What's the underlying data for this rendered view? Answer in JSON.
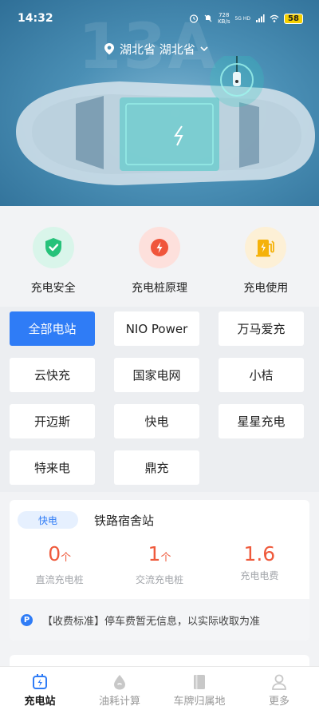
{
  "status_bar": {
    "time": "14:32",
    "network_speed_value": "728",
    "network_speed_unit": "KB/s",
    "network_type": "5G HD",
    "battery": "58"
  },
  "hero": {
    "background_text": "13A",
    "location": "湖北省 湖北省"
  },
  "features": [
    {
      "label": "充电安全",
      "icon": "shield-check-icon"
    },
    {
      "label": "充电桩原理",
      "icon": "lightning-icon"
    },
    {
      "label": "充电使用",
      "icon": "charging-pile-icon"
    }
  ],
  "filters": {
    "selected": "全部电站",
    "items": [
      "全部电站",
      "NIO Power",
      "万马爱充",
      "云快充",
      "国家电网",
      "小桔",
      "开迈斯",
      "快电",
      "星星充电",
      "特来电",
      "鼎充"
    ]
  },
  "station": {
    "type": "快电",
    "name": "铁路宿舍站",
    "dc_count": "0",
    "dc_unit": "个",
    "dc_label": "直流充电桩",
    "ac_count": "1",
    "ac_unit": "个",
    "ac_label": "交流充电桩",
    "fee": "1.6",
    "fee_label": "充电电费",
    "parking_icon": "P",
    "parking_note": "【收费标准】停车费暂无信息，以实际收取为准"
  },
  "bottom_nav": [
    {
      "label": "充电站",
      "icon": "charging-station-icon",
      "active": true
    },
    {
      "label": "油耗计算",
      "icon": "fuel-drop-icon",
      "active": false
    },
    {
      "label": "车牌归属地",
      "icon": "book-icon",
      "active": false
    },
    {
      "label": "更多",
      "icon": "user-icon",
      "active": false
    }
  ],
  "colors": {
    "accent": "#2f7cf6",
    "highlight_number": "#ef5a3c",
    "hero_bg": "#4a8fb5"
  }
}
